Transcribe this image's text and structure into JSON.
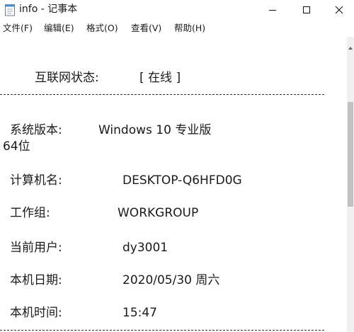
{
  "window": {
    "title": "info - 记事本"
  },
  "menu": [
    {
      "label": "文件(F)"
    },
    {
      "label": "编辑(E)"
    },
    {
      "label": "格式(O)"
    },
    {
      "label": "查看(V)"
    },
    {
      "label": "帮助(H)"
    }
  ],
  "content": {
    "network_label": "互联网状态:",
    "network_value": "[ 在线 ]",
    "rows": [
      {
        "label": "系统版本:",
        "value": "Windows 10 专业版",
        "extra": "64位"
      },
      {
        "label": "计算机名:",
        "value": "DESKTOP-Q6HFD0G"
      },
      {
        "label": "工作组:",
        "value": "WORKGROUP"
      },
      {
        "label": "当前用户:",
        "value": "dy3001"
      },
      {
        "label": "本机日期:",
        "value": "2020/05/30 周六"
      },
      {
        "label": "本机时间:",
        "value": "15:47"
      }
    ]
  },
  "icons": {
    "app": "notepad-icon",
    "minimize": "minimize-icon",
    "maximize": "maximize-icon",
    "close": "close-icon",
    "scroll_up": "scroll-up-arrow-icon"
  }
}
